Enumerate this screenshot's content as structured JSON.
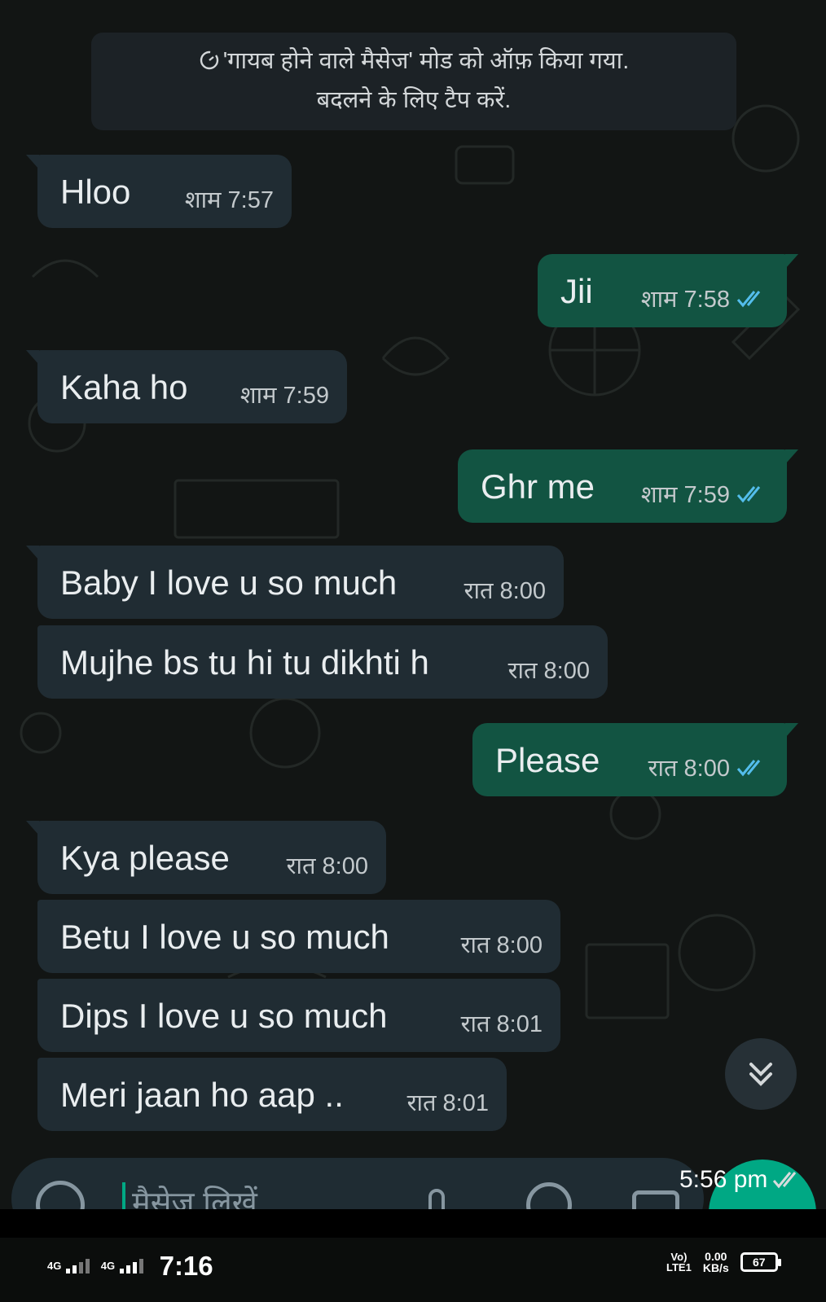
{
  "system_notice": {
    "icon": "timer-icon",
    "line1": "'गायब होने वाले मैसेज' मोड को ऑफ़ किया गया.",
    "line2": "बदलने के लिए टैप करें."
  },
  "messages": [
    {
      "direction": "in",
      "text": "Hloo",
      "time": "शाम 7:57"
    },
    {
      "direction": "out",
      "text": "Jii",
      "time": "शाम 7:58",
      "status": "read"
    },
    {
      "direction": "in",
      "text": "Kaha ho",
      "time": "शाम 7:59"
    },
    {
      "direction": "out",
      "text": "Ghr me",
      "time": "शाम 7:59",
      "status": "read"
    },
    {
      "direction": "in",
      "text": "Baby I love u so much",
      "time": "रात 8:00"
    },
    {
      "direction": "in",
      "text": "Mujhe bs tu hi tu dikhti h",
      "time": "रात 8:00"
    },
    {
      "direction": "out",
      "text": "Please",
      "time": "रात 8:00",
      "status": "read"
    },
    {
      "direction": "in",
      "text": "Kya please",
      "time": "रात 8:00"
    },
    {
      "direction": "in",
      "text": "Betu I love u so much",
      "time": "रात 8:00"
    },
    {
      "direction": "in",
      "text": "Dips I love u so much",
      "time": "रात 8:01"
    },
    {
      "direction": "in",
      "text": "Meri jaan ho aap ..",
      "time": "रात 8:01"
    }
  ],
  "composer": {
    "placeholder": "मैसेज लिखें",
    "icons": [
      "emoji-icon",
      "attach-icon",
      "rupee-icon",
      "camera-icon",
      "mic-icon"
    ]
  },
  "overlay_timestamp": "5:56 pm",
  "status_bar": {
    "sim1_network": "4G",
    "sim2_network": "4G",
    "clock": "7:16",
    "volte": "Vo)",
    "lte": "LTE1",
    "net_speed": "0.00",
    "net_speed_unit": "KB/s",
    "battery": "67"
  },
  "colors": {
    "incoming_bubble": "#202c33",
    "outgoing_bubble": "#125442",
    "read_tick": "#53bdeb",
    "accent": "#00a884"
  }
}
